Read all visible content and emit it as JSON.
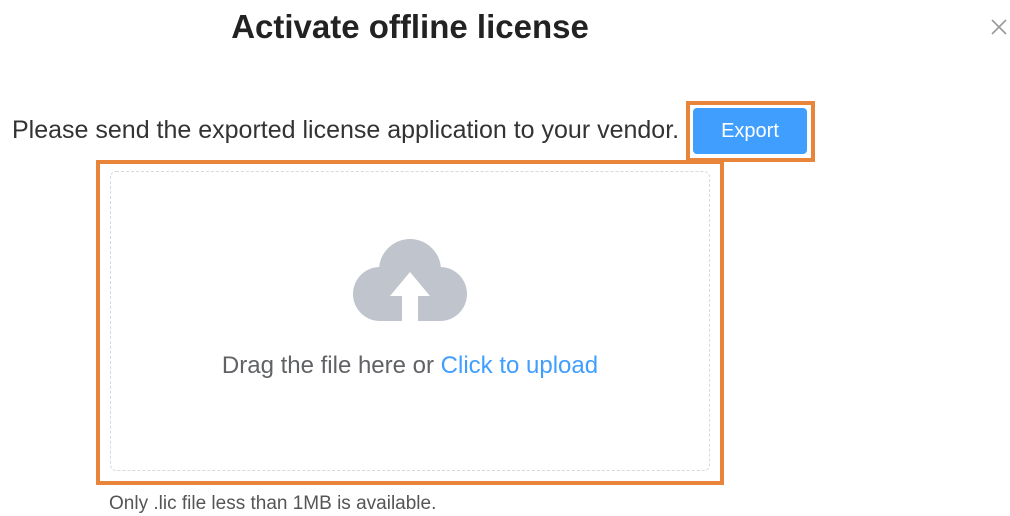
{
  "dialog": {
    "title": "Activate offline license",
    "close_icon": "close-icon"
  },
  "export_section": {
    "instruction": "Please send the exported license application to your vendor.",
    "export_label": "Export"
  },
  "upload": {
    "icon": "cloud-upload-icon",
    "drag_text": "Drag the file here or ",
    "click_link": "Click to upload",
    "tip": "Only .lic file less than 1MB is available."
  },
  "colors": {
    "accent": "#409eff",
    "highlight": "#e8853a",
    "icon_gray": "#c0c4cc"
  }
}
